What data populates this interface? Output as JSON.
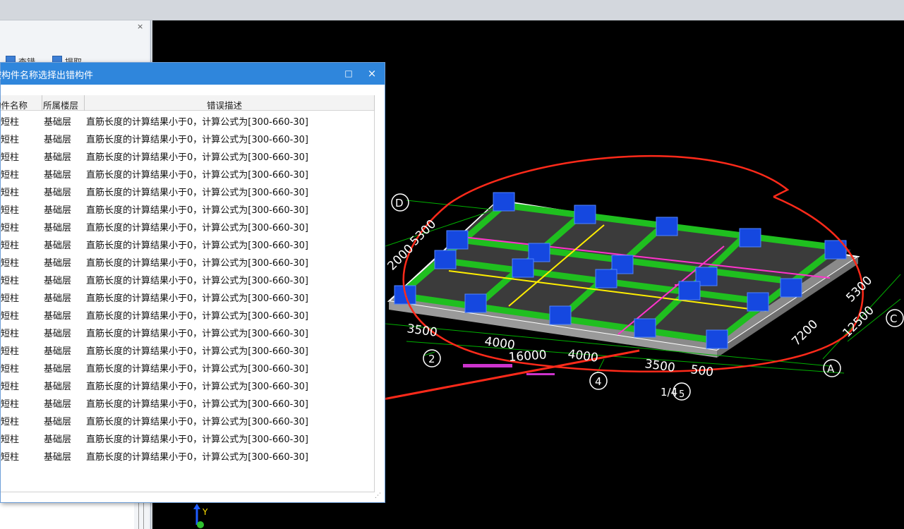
{
  "left_panel": {
    "close_glyph": "×",
    "check1_label": "查错",
    "check2_label": "提取"
  },
  "dialog": {
    "title": "按构件名称选择出错构件",
    "maximize_glyph": "□",
    "close_glyph": "×",
    "columns": [
      "构件名称",
      "所属楼层",
      "错误描述"
    ],
    "rows": [
      {
        "name": "短柱",
        "floor": "基础层",
        "desc": "直筋长度的计算结果小于0，计算公式为[300-660-30]"
      },
      {
        "name": "短柱",
        "floor": "基础层",
        "desc": "直筋长度的计算结果小于0，计算公式为[300-660-30]"
      },
      {
        "name": "短柱",
        "floor": "基础层",
        "desc": "直筋长度的计算结果小于0，计算公式为[300-660-30]"
      },
      {
        "name": "短柱",
        "floor": "基础层",
        "desc": "直筋长度的计算结果小于0，计算公式为[300-660-30]"
      },
      {
        "name": "短柱",
        "floor": "基础层",
        "desc": "直筋长度的计算结果小于0，计算公式为[300-660-30]"
      },
      {
        "name": "短柱",
        "floor": "基础层",
        "desc": "直筋长度的计算结果小于0，计算公式为[300-660-30]"
      },
      {
        "name": "短柱",
        "floor": "基础层",
        "desc": "直筋长度的计算结果小于0，计算公式为[300-660-30]"
      },
      {
        "name": "短柱",
        "floor": "基础层",
        "desc": "直筋长度的计算结果小于0，计算公式为[300-660-30]"
      },
      {
        "name": "短柱",
        "floor": "基础层",
        "desc": "直筋长度的计算结果小于0，计算公式为[300-660-30]"
      },
      {
        "name": "短柱",
        "floor": "基础层",
        "desc": "直筋长度的计算结果小于0，计算公式为[300-660-30]"
      },
      {
        "name": "短柱",
        "floor": "基础层",
        "desc": "直筋长度的计算结果小于0，计算公式为[300-660-30]"
      },
      {
        "name": "短柱",
        "floor": "基础层",
        "desc": "直筋长度的计算结果小于0，计算公式为[300-660-30]"
      },
      {
        "name": "短柱",
        "floor": "基础层",
        "desc": "直筋长度的计算结果小于0，计算公式为[300-660-30]"
      },
      {
        "name": "短柱",
        "floor": "基础层",
        "desc": "直筋长度的计算结果小于0，计算公式为[300-660-30]"
      },
      {
        "name": "短柱",
        "floor": "基础层",
        "desc": "直筋长度的计算结果小于0，计算公式为[300-660-30]"
      },
      {
        "name": "短柱",
        "floor": "基础层",
        "desc": "直筋长度的计算结果小于0，计算公式为[300-660-30]"
      },
      {
        "name": "短柱",
        "floor": "基础层",
        "desc": "直筋长度的计算结果小于0，计算公式为[300-660-30]"
      },
      {
        "name": "短柱",
        "floor": "基础层",
        "desc": "直筋长度的计算结果小于0，计算公式为[300-660-30]"
      },
      {
        "name": "短柱",
        "floor": "基础层",
        "desc": "直筋长度的计算结果小于0，计算公式为[300-660-30]"
      },
      {
        "name": "短柱",
        "floor": "基础层",
        "desc": "直筋长度的计算结果小于0，计算公式为[300-660-30]"
      }
    ]
  },
  "viewport": {
    "axis_labels": {
      "d": "D",
      "c": "C",
      "a": "A",
      "n2": "2",
      "n4": "4",
      "n1_4": "1/4",
      "n5": "5"
    },
    "dimensions": {
      "d5300_left": "5300",
      "d2000_left": "2000",
      "d3500_a": "3500",
      "d4000_a": "4000",
      "d16000": "16000",
      "d4000_b": "4000",
      "d3500_b": "3500",
      "d500": "500",
      "d7200": "7200",
      "d12500": "12500",
      "d5300_right": "5300"
    },
    "colors": {
      "beam": "#1fbf1f",
      "column": "#1548e0",
      "slab": "#3a3a3a",
      "grid_line": "#00cc00",
      "annotation": "#ff2a1a",
      "magenta_line": "#ff33cc",
      "yellow_line": "#ffee00"
    },
    "coord_axis_label": "Y"
  }
}
